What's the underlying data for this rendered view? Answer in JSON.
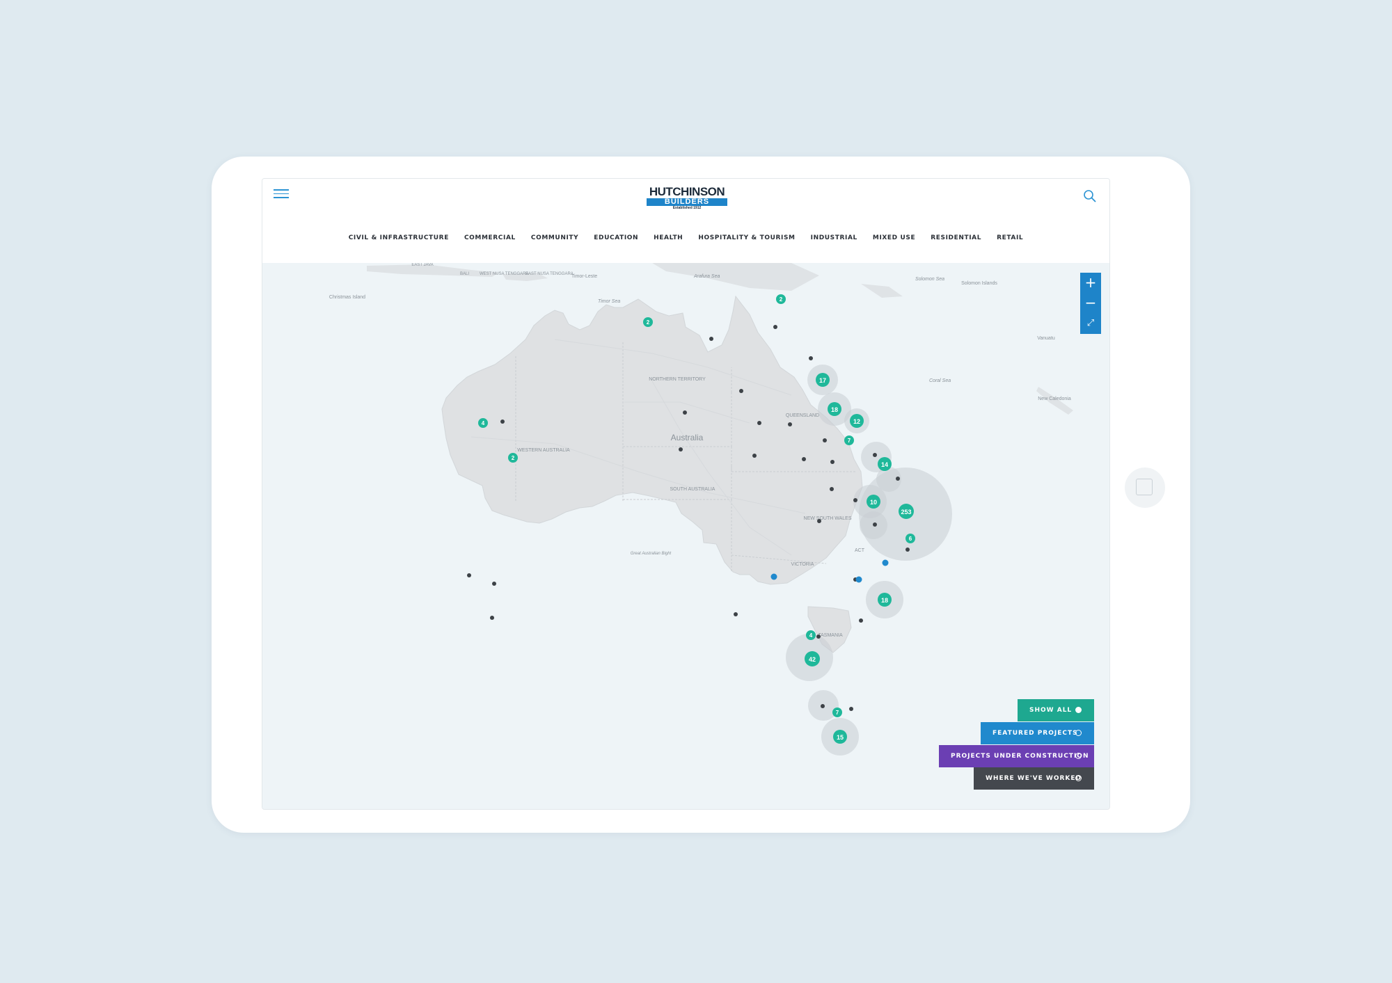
{
  "header": {
    "logo": {
      "title": "HUTCHINSON",
      "bar": "BUILDERS",
      "sub": "Established 1912"
    },
    "nav": [
      "CIVIL & INFRASTRUCTURE",
      "COMMERCIAL",
      "COMMUNITY",
      "EDUCATION",
      "HEALTH",
      "HOSPITALITY & TOURISM",
      "INDUSTRIAL",
      "MIXED USE",
      "RESIDENTIAL",
      "RETAIL"
    ]
  },
  "map": {
    "labels": {
      "christmas": "Christmas Island",
      "eastjava": "EAST JAVA",
      "bali": "BALI",
      "wnt": "WEST NUSA TENGGARA",
      "ent": "EAST NUSA TENGGARA",
      "timorleste": "Timor-Leste",
      "arafura": "Arafura Sea",
      "timorsea": "Timor Sea",
      "solomonsea": "Solomon Sea",
      "solomonis": "Solomon Islands",
      "vanuatu": "Vanuatu",
      "coralsea": "Coral Sea",
      "newcaledonia": "New Caledonia",
      "nt": "NORTHERN TERRITORY",
      "australia": "Australia",
      "qld": "QUEENSLAND",
      "wa": "WESTERN AUSTRALIA",
      "sa": "SOUTH AUSTRALIA",
      "nsw": "NEW SOUTH WALES",
      "act": "ACT",
      "vic": "VICTORIA",
      "tas": "TASMANIA",
      "bight": "Great Australian Bight"
    },
    "clusters": [
      "2",
      "2",
      "17",
      "18",
      "12",
      "7",
      "4",
      "2",
      "14",
      "10",
      "253",
      "6",
      "18",
      "4",
      "42",
      "7",
      "15"
    ],
    "zoom": {
      "in": "+",
      "out": "−",
      "fullscreen": "⤢"
    }
  },
  "filters": [
    {
      "label": "SHOW ALL",
      "color": "#1ea890",
      "selected": true
    },
    {
      "label": "FEATURED PROJECTS",
      "color": "#2089cd",
      "selected": false
    },
    {
      "label": "PROJECTS UNDER CONSTRUCTION",
      "color": "#6b3fb3",
      "selected": false
    },
    {
      "label": "WHERE WE'VE WORKED",
      "color": "#44484e",
      "selected": false
    }
  ],
  "colors": {
    "accent": "#1e84c9",
    "cluster": "#1fb89a",
    "background": "#dfeaf0"
  }
}
